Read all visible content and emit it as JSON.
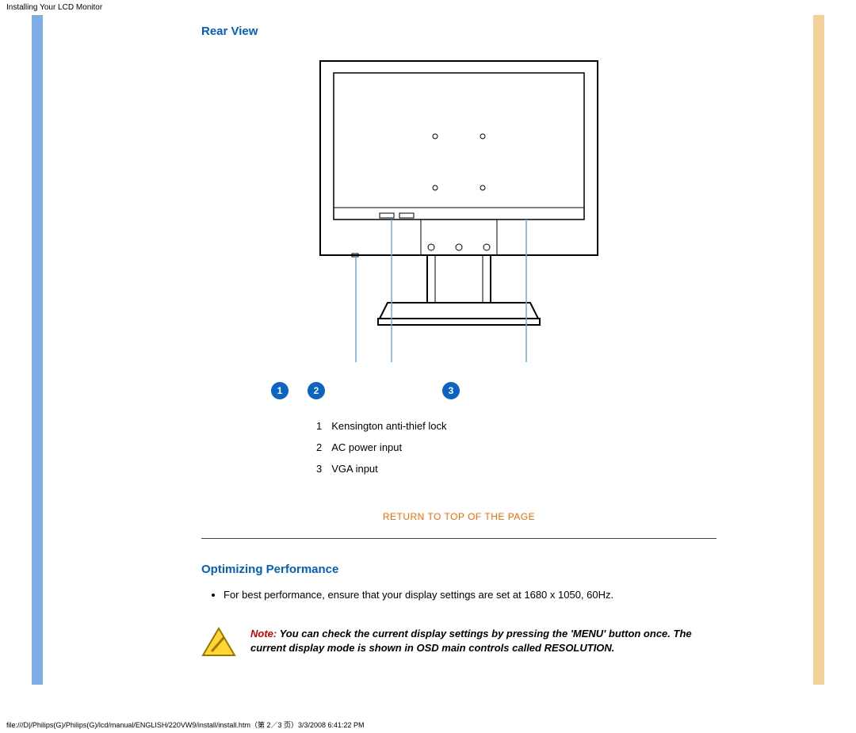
{
  "header": {
    "title": "Installing Your LCD Monitor"
  },
  "rear_view": {
    "heading": "Rear View",
    "callouts": [
      "1",
      "2",
      "3"
    ],
    "labels": [
      {
        "num": "1",
        "text": "Kensington anti-thief lock"
      },
      {
        "num": "2",
        "text": "AC power input"
      },
      {
        "num": "3",
        "text": "VGA input"
      }
    ]
  },
  "return_link": "RETURN TO TOP OF THE PAGE",
  "optimizing": {
    "heading": "Optimizing Performance",
    "bullet": "For best performance, ensure that your display settings are set at 1680 x 1050, 60Hz.",
    "note_label": "Note:",
    "note_body": " You can check the current display settings by pressing the 'MENU' button once. The current display mode is shown in OSD main controls called RESOLUTION."
  },
  "footer": {
    "path": "file:///D|/Philips(G)/Philips(G)/lcd/manual/ENGLISH/220VW9/install/install.htm（第 2／3 页）3/3/2008 6:41:22 PM"
  }
}
